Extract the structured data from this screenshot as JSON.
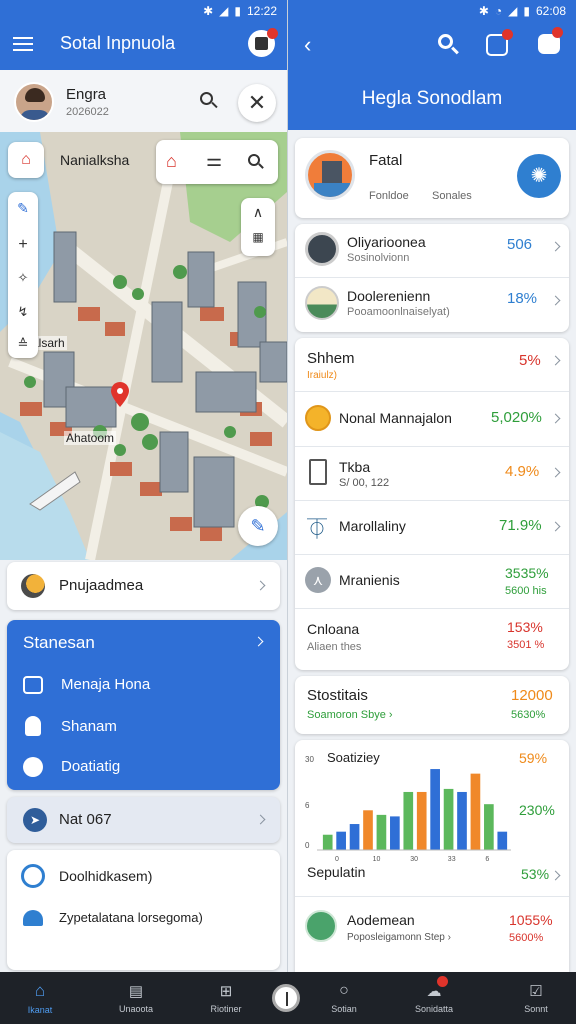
{
  "status_left": {
    "time": "12:22"
  },
  "status_right": {
    "time": "62:08"
  },
  "left": {
    "app_title": "Sotal Inpnuola",
    "profile": {
      "name": "Engra",
      "sub": "2026022"
    },
    "map": {
      "layer_label": "Nanialksha",
      "district_label": "Rtalsarh",
      "area_label": "Ahatoom"
    },
    "project_row": {
      "label": "Pnujaadmea"
    },
    "panel": {
      "title": "Stanesan",
      "items": [
        {
          "label": "Menaja Hona"
        },
        {
          "label": "Shanam"
        },
        {
          "label": "Doatiatig"
        }
      ]
    },
    "row_nat": {
      "label": "Nat 067"
    },
    "bottom_card": {
      "items": [
        {
          "label": "Doolhidkasem)"
        },
        {
          "label": "Zypetalatana lorsegoma)"
        }
      ]
    }
  },
  "right": {
    "header_title": "Hegla Sonodlam",
    "featured": {
      "title": "Fatal",
      "tag1": "Fonldoe",
      "tag2": "Sonales"
    },
    "list1": [
      {
        "title": "Oliyarioonea",
        "sub": "Sosinolvionn",
        "value": "506",
        "color": "#2f7fd0"
      },
      {
        "title": "Doolerenienn",
        "sub": "Pooamoonlnaiselyat)",
        "value": "18%",
        "color": "#2f7fd0"
      }
    ],
    "section1": {
      "title": "Shhem",
      "sub": "Iraiulz)",
      "value": "5%",
      "value_color": "#d8342c"
    },
    "list2": [
      {
        "title": "Nonal Mannajalon",
        "sub": "",
        "value": "5,020%",
        "value2": "",
        "color": "#2e9e3a"
      },
      {
        "title": "Tkba",
        "sub": "S/ 00, 122",
        "value": "4.9%",
        "value2": "",
        "color": "#ef8a1a"
      },
      {
        "title": "Marollaliny",
        "sub": "",
        "value": "71.9%",
        "value2": "",
        "color": "#2e9e3a"
      },
      {
        "title": "Mranienis",
        "sub": "",
        "value": "3535%",
        "value2": "5600 his",
        "color": "#2e9e3a"
      },
      {
        "title": "Cnloana",
        "sub": "Aliaen thes",
        "value": "153%",
        "value2": "3501 %",
        "color": "#d8342c"
      }
    ],
    "stats": {
      "title": "Stostitais",
      "sub": "Soamoron Sbye ›",
      "value": "12000",
      "value2": "5630%"
    },
    "chart_card": {
      "title": "Soatiziey",
      "value_top": "59%",
      "value_mid": "230%",
      "value_bottom": "53%",
      "footer": "Sepulatin"
    },
    "chart_data": {
      "type": "bar",
      "ytick_labels": [
        "30",
        "6",
        "0"
      ],
      "xtick_labels": [
        "0",
        "10",
        "30",
        "33",
        "6"
      ],
      "values": [
        1,
        1.2,
        1.7,
        2.6,
        2.3,
        2.2,
        3.8,
        3.8,
        5.3,
        4.0,
        3.8,
        5.0,
        3.0,
        1.2
      ],
      "bar_colors": [
        "#5cb85c",
        "#2f6fd6",
        "#2f6fd6",
        "#f0882a",
        "#5cb85c",
        "#2f6fd6",
        "#5cb85c",
        "#f0882a",
        "#2f6fd6",
        "#5cb85c",
        "#2f6fd6",
        "#f0882a",
        "#5cb85c",
        "#2f6fd6"
      ]
    },
    "last_row": {
      "title": "Aodemean",
      "sub": "Poposleigamonn Step ›",
      "value": "1055%",
      "value2": "5600%"
    }
  },
  "nav": [
    {
      "label": "Ikanat",
      "icon": "home-icon",
      "active": true
    },
    {
      "label": "Unaoota",
      "icon": "inbox-icon",
      "active": false
    },
    {
      "label": "Riotiner",
      "icon": "book-icon",
      "active": false
    },
    {
      "label": "",
      "icon": "center-circle-icon",
      "active": false
    },
    {
      "label": "Sotian",
      "icon": "search-icon",
      "active": false
    },
    {
      "label": "Sonidatta",
      "icon": "cloud-icon",
      "active": false
    },
    {
      "label": "Sonnt",
      "icon": "task-icon",
      "active": false
    }
  ],
  "colors": {
    "primary": "#2f6fd6",
    "green": "#2e9e3a",
    "red": "#d8342c",
    "orange": "#ef8a1a",
    "nav_bg": "#1e2228"
  }
}
